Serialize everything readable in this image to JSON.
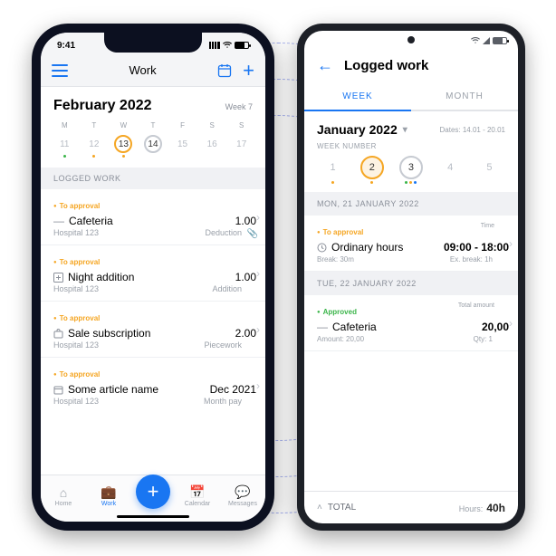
{
  "iphone": {
    "status": {
      "time": "9:41"
    },
    "appbar": {
      "title": "Work"
    },
    "month_label": "February  2022",
    "week_label": "Week 7",
    "daynames": [
      "M",
      "T",
      "W",
      "T",
      "F",
      "S",
      "S"
    ],
    "dates": [
      "11",
      "12",
      "13",
      "14",
      "15",
      "16",
      "17"
    ],
    "section_logged": "LOGGED WORK",
    "entries": [
      {
        "status": "To approval",
        "title": "Cafeteria",
        "value": "1.00",
        "place": "Hospital 123",
        "type": "Deduction",
        "clip": true
      },
      {
        "status": "To approval",
        "title": "Night addition",
        "value": "1.00",
        "place": "Hospital 123",
        "type": "Addition"
      },
      {
        "status": "To approval",
        "title": "Sale subscription",
        "value": "2.00",
        "place": "Hospital 123",
        "type": "Piecework"
      },
      {
        "status": "To approval",
        "title": "Some article name",
        "value": "Dec 2021",
        "place": "Hospital 123",
        "type": "Month pay"
      }
    ],
    "tabs": {
      "home": "Home",
      "work": "Work",
      "calendar": "Calendar",
      "messages": "Messages"
    }
  },
  "android": {
    "appbar": {
      "title": "Logged work"
    },
    "tabs": {
      "week": "WEEK",
      "month": "MONTH"
    },
    "month_label": "January  2022",
    "dates_label": "Dates: 14.01 - 20.01",
    "weeknum_label": "WEEK NUMBER",
    "weeks": [
      "1",
      "2",
      "3",
      "4",
      "5"
    ],
    "sections": [
      {
        "heading": "MON, 21 JANUARY 2022",
        "status": "To approval",
        "time_lbl": "Time",
        "title": "Ordinary hours",
        "value": "09:00 - 18:00",
        "left": "Break: 30m",
        "right": "Ex. break: 1h"
      },
      {
        "heading": "TUE, 22 JANUARY 2022",
        "status": "Approved",
        "time_lbl": "Total amount",
        "title": "Cafeteria",
        "value": "20,00",
        "left": "Amount: 20,00",
        "right": "Qty: 1"
      }
    ],
    "total": {
      "label": "TOTAL",
      "hours_lbl": "Hours:",
      "hours": "40h"
    }
  }
}
